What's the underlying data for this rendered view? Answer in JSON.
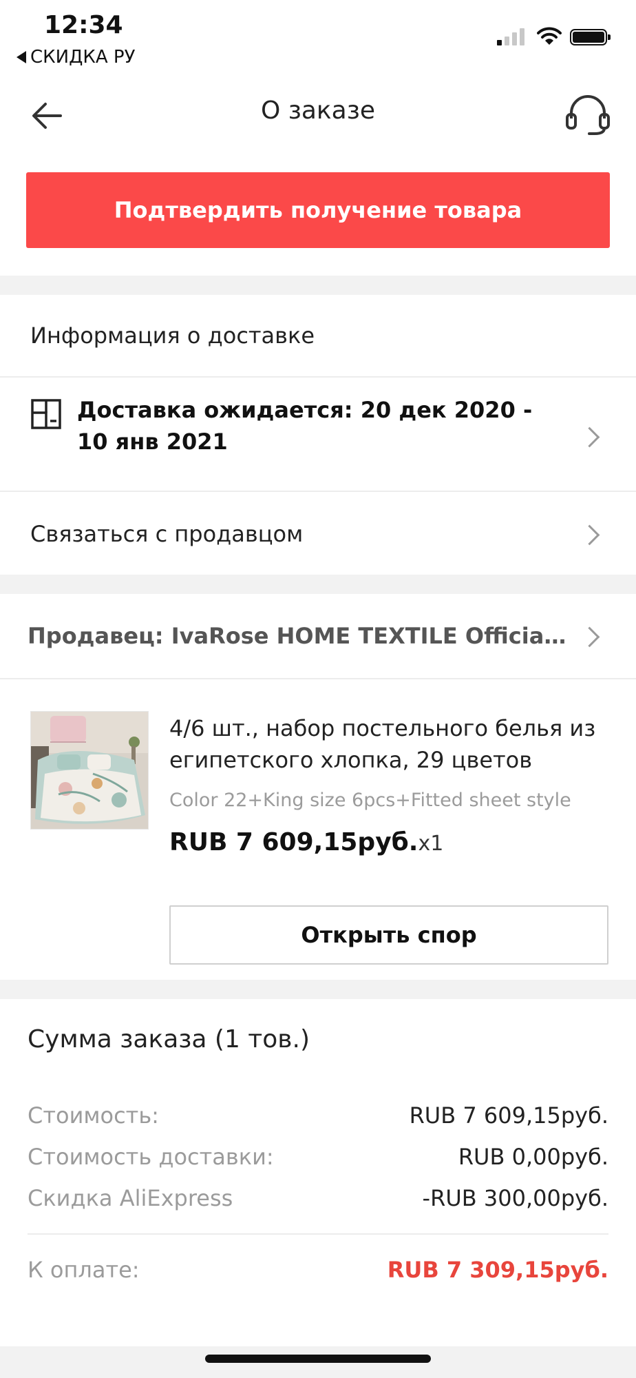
{
  "status_bar": {
    "time": "12:34",
    "back_app": "СКИДКА РУ"
  },
  "header": {
    "title": "О заказе"
  },
  "confirm_button_label": "Подтвердить получение товара",
  "delivery": {
    "section_title": "Информация о доставке",
    "expected_text": "Доставка ожидается: 20 дек 2020 - 10 янв 2021",
    "contact_seller_label": "Связаться с продавцом"
  },
  "seller": {
    "label": "Продавец: IvaRose HOME TEXTILE Official Store"
  },
  "product": {
    "title": "4/6 шт., набор постельного белья из египетского хлопка, 29 цветов",
    "variant": "Color 22+King size 6pcs+Fitted sheet style",
    "price": "RUB 7 609,15руб.",
    "quantity": "x1",
    "dispute_button_label": "Открыть спор"
  },
  "summary": {
    "title": "Сумма заказа (1 тов.)",
    "rows": [
      {
        "label": "Стоимость:",
        "value": "RUB 7 609,15руб."
      },
      {
        "label": "Стоимость доставки:",
        "value": "RUB 0,00руб."
      },
      {
        "label": "Скидка AliExpress",
        "value": "-RUB 300,00руб."
      }
    ],
    "total_label": "К оплате:",
    "total_value": "RUB 7 309,15руб."
  },
  "colors": {
    "accent": "#fb4949",
    "total_price": "#e8453c"
  }
}
